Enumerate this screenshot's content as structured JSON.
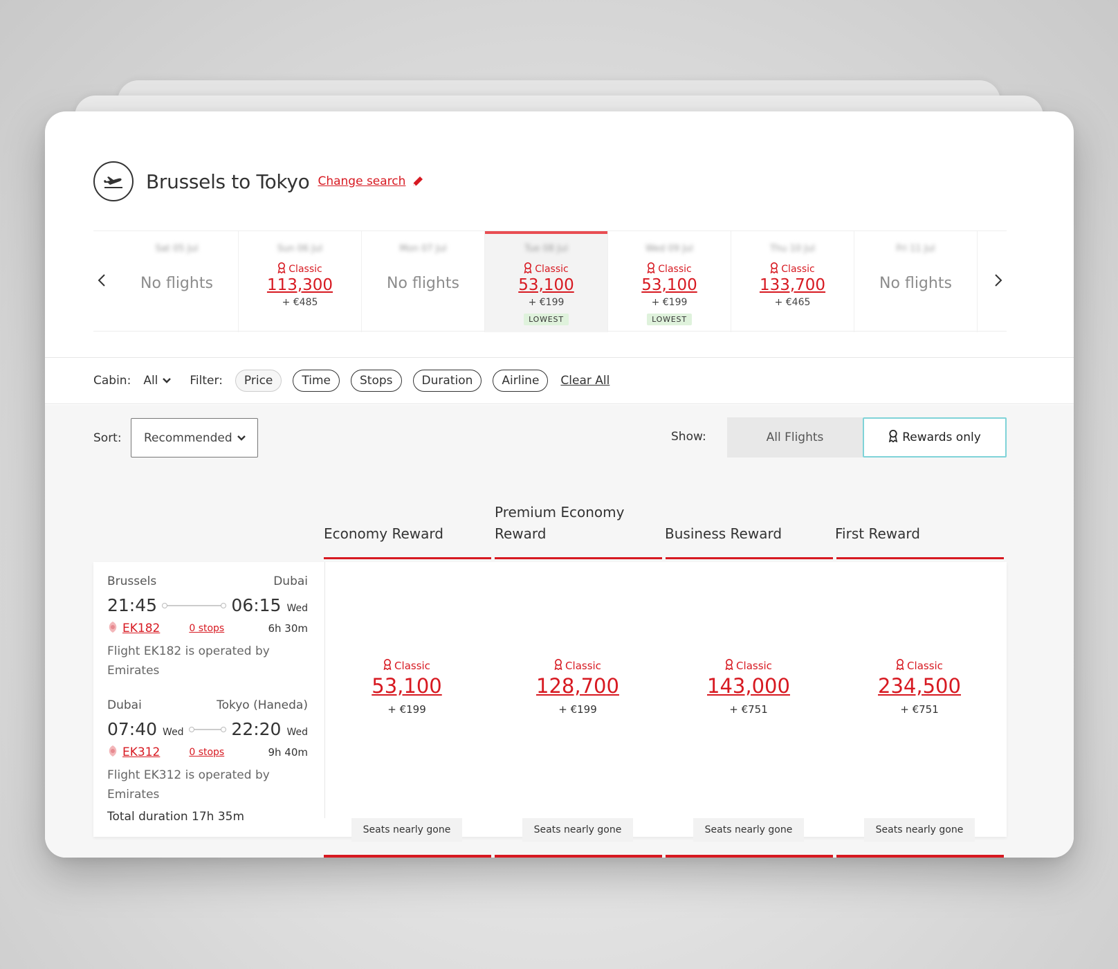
{
  "header": {
    "title": "Brussels to Tokyo",
    "change_link": "Change search"
  },
  "date_strip": {
    "days": [
      {
        "date": "Sat 05 Jul",
        "no_flights": "No flights"
      },
      {
        "date": "Sun 06 Jul",
        "fare_type": "Classic",
        "price": "113,300",
        "fee": "+ €485"
      },
      {
        "date": "Mon 07 Jul",
        "no_flights": "No flights"
      },
      {
        "date": "Tue 08 Jul",
        "fare_type": "Classic",
        "price": "53,100",
        "fee": "+ €199",
        "badge": "LOWEST",
        "selected": true
      },
      {
        "date": "Wed 09 Jul",
        "fare_type": "Classic",
        "price": "53,100",
        "fee": "+ €199",
        "badge": "LOWEST"
      },
      {
        "date": "Thu 10 Jul",
        "fare_type": "Classic",
        "price": "133,700",
        "fee": "+ €465"
      },
      {
        "date": "Fri 11 Jul",
        "no_flights": "No flights"
      }
    ]
  },
  "filters": {
    "cabin_label": "Cabin:",
    "cabin_value": "All",
    "filter_label": "Filter:",
    "chips": [
      "Price",
      "Time",
      "Stops",
      "Duration",
      "Airline"
    ],
    "clear_all": "Clear All"
  },
  "sort": {
    "label": "Sort:",
    "value": "Recommended"
  },
  "show": {
    "label": "Show:",
    "all_flights": "All Flights",
    "rewards_only": "Rewards only"
  },
  "columns": [
    {
      "line1": "",
      "line2": "Economy Reward"
    },
    {
      "line1": "Premium Economy",
      "line2": "Reward"
    },
    {
      "line1": "",
      "line2": "Business Reward"
    },
    {
      "line1": "",
      "line2": "First Reward"
    }
  ],
  "result": {
    "segments": [
      {
        "from": "Brussels",
        "to": "Dubai",
        "dep": "21:45",
        "dep_day": "",
        "arr": "06:15",
        "arr_day": "Wed",
        "flight": "EK182",
        "stops": "0 stops",
        "duration": "6h 30m",
        "operated_1": "Flight EK182 is operated by",
        "operated_2": "Emirates"
      },
      {
        "from": "Dubai",
        "to": "Tokyo (Haneda)",
        "dep": "07:40",
        "dep_day": "Wed",
        "arr": "22:20",
        "arr_day": "Wed",
        "flight": "EK312",
        "stops": "0 stops",
        "duration": "9h 40m",
        "operated_1": "Flight EK312 is operated by",
        "operated_2": "Emirates"
      }
    ],
    "total": "Total duration 17h 35m",
    "fares": [
      {
        "type": "Classic",
        "price": "53,100",
        "fee": "+ €199",
        "availability": "Seats nearly gone"
      },
      {
        "type": "Classic",
        "price": "128,700",
        "fee": "+ €199",
        "availability": "Seats nearly gone"
      },
      {
        "type": "Classic",
        "price": "143,000",
        "fee": "+ €751",
        "availability": "Seats nearly gone"
      },
      {
        "type": "Classic",
        "price": "234,500",
        "fee": "+ €751",
        "availability": "Seats nearly gone"
      }
    ]
  },
  "colors": {
    "accent": "#d71921",
    "lowest_bg": "#dff2dc",
    "rewards_border": "#7fd3d8"
  }
}
